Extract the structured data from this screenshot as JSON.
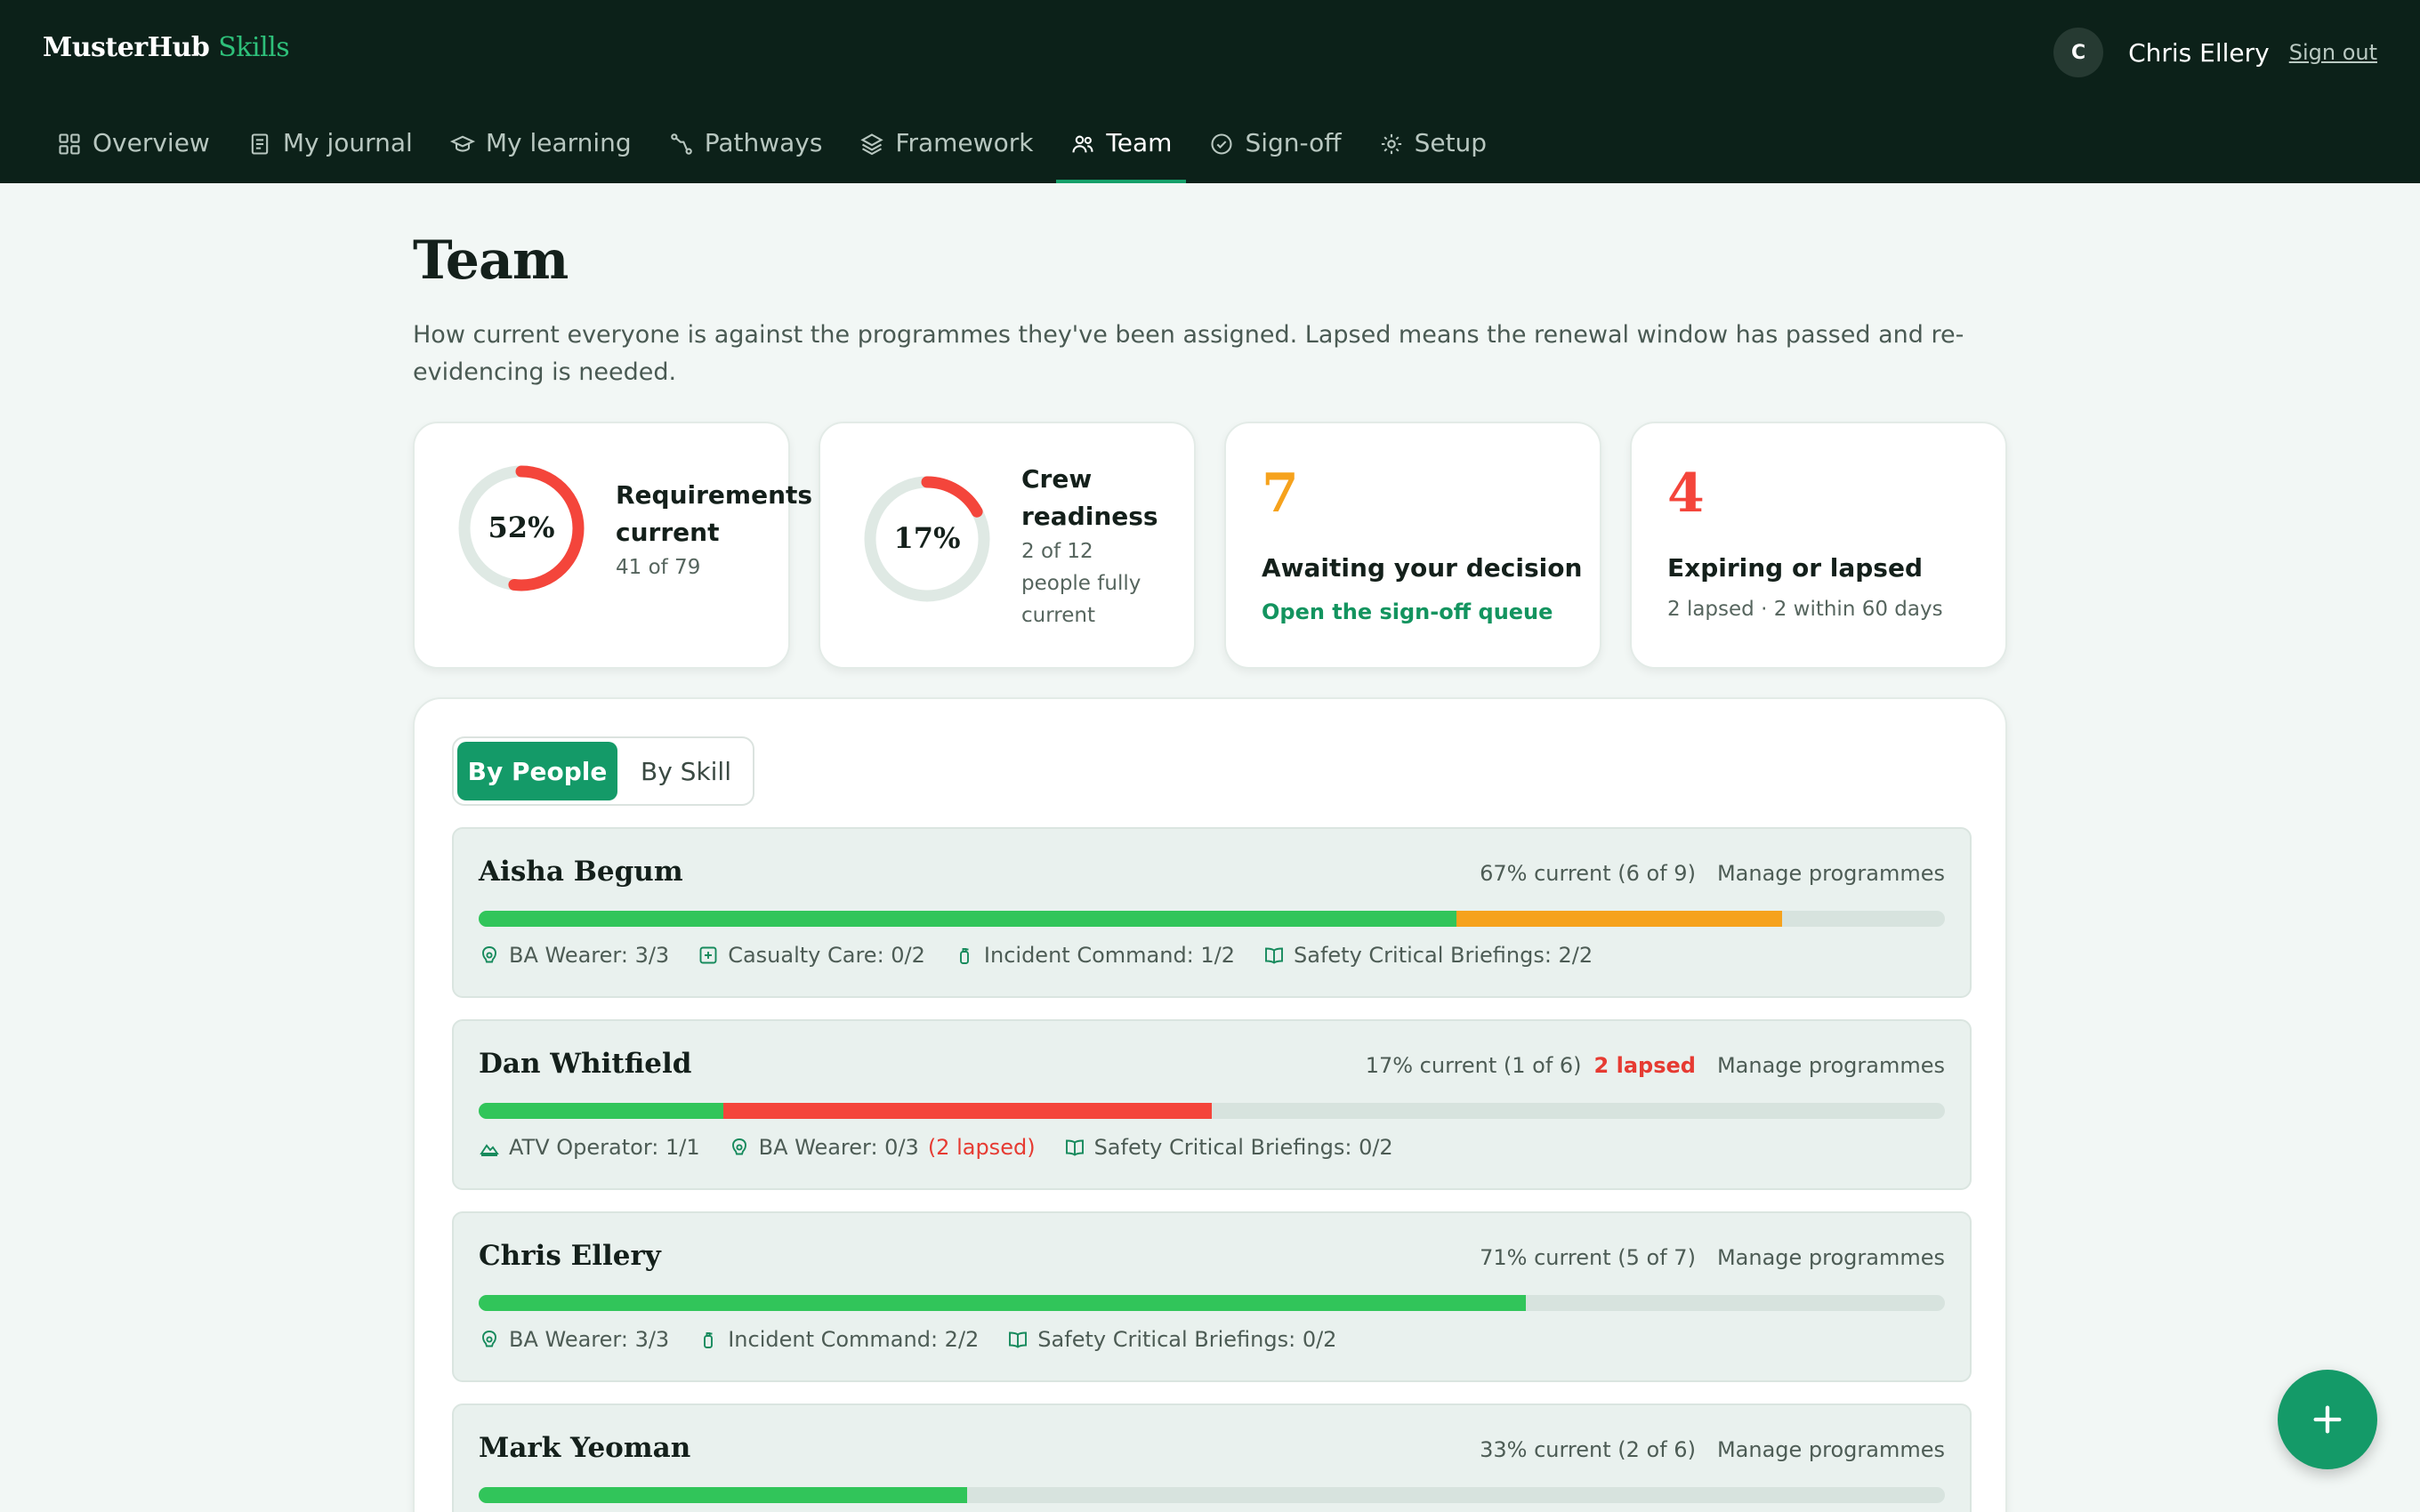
{
  "brand": {
    "name": "MusterHub",
    "accent": "Skills"
  },
  "user": {
    "initial": "C",
    "name": "Chris Ellery",
    "sign_out": "Sign out"
  },
  "nav": {
    "items": [
      {
        "label": "Overview",
        "icon": "grid-icon"
      },
      {
        "label": "My journal",
        "icon": "journal-icon"
      },
      {
        "label": "My learning",
        "icon": "graduation-cap-icon"
      },
      {
        "label": "Pathways",
        "icon": "route-icon"
      },
      {
        "label": "Framework",
        "icon": "layers-icon"
      },
      {
        "label": "Team",
        "icon": "users-icon",
        "active": true
      },
      {
        "label": "Sign-off",
        "icon": "check-circle-icon"
      },
      {
        "label": "Setup",
        "icon": "gear-icon"
      }
    ]
  },
  "page": {
    "title": "Team",
    "description": "How current everyone is against the programmes they've been assigned. Lapsed means the renewal window has passed and re-evidencing is needed."
  },
  "stats": {
    "requirements": {
      "percent_label": "52%",
      "fraction": 0.52,
      "title_line1": "Requirements",
      "title_line2": "current",
      "sub": "41 of 79",
      "color": "#f4453b"
    },
    "readiness": {
      "percent_label": "17%",
      "fraction": 0.17,
      "title_line1": "Crew",
      "title_line2": "readiness",
      "sub_line1": "2 of 12",
      "sub_line2": "people fully",
      "sub_line3": "current",
      "color": "#f4453b"
    },
    "awaiting": {
      "number": "7",
      "heading": "Awaiting your decision",
      "link": "Open the sign-off queue",
      "color": "#f6a21c"
    },
    "expiring": {
      "number": "4",
      "heading": "Expiring or lapsed",
      "sub": "2 lapsed · 2 within 60 days",
      "color": "#f4453b"
    }
  },
  "view_toggle": {
    "by_people": "By People",
    "by_skill": "By Skill"
  },
  "colors": {
    "current": "#31c55a",
    "expiring": "#f6a21c",
    "lapsed": "#f4453b",
    "accent": "#149a68"
  },
  "people": [
    {
      "name": "Aisha Begum",
      "summary": "67% current (6 of 9)",
      "lapsed_label": "",
      "manage": "Manage programmes",
      "current_fraction": 0.667,
      "expiring_fraction": 0.222,
      "lapsed_fraction": 0,
      "chips": [
        {
          "icon": "mask-icon",
          "label": "BA Wearer: 3/3",
          "lapse": ""
        },
        {
          "icon": "medical-plus-icon",
          "label": "Casualty Care: 0/2",
          "lapse": ""
        },
        {
          "icon": "extinguisher-icon",
          "label": "Incident Command: 1/2",
          "lapse": ""
        },
        {
          "icon": "book-icon",
          "label": "Safety Critical Briefings: 2/2",
          "lapse": ""
        }
      ]
    },
    {
      "name": "Dan Whitfield",
      "summary": "17% current (1 of 6)",
      "lapsed_label": "2 lapsed",
      "manage": "Manage programmes",
      "current_fraction": 0.167,
      "expiring_fraction": 0,
      "lapsed_fraction": 0.333,
      "chips": [
        {
          "icon": "terrain-icon",
          "label": "ATV Operator: 1/1",
          "lapse": ""
        },
        {
          "icon": "mask-icon",
          "label": "BA Wearer: 0/3",
          "lapse": "(2 lapsed)"
        },
        {
          "icon": "book-icon",
          "label": "Safety Critical Briefings: 0/2",
          "lapse": ""
        }
      ]
    },
    {
      "name": "Chris Ellery",
      "summary": "71% current (5 of 7)",
      "lapsed_label": "",
      "manage": "Manage programmes",
      "current_fraction": 0.714,
      "expiring_fraction": 0,
      "lapsed_fraction": 0,
      "chips": [
        {
          "icon": "mask-icon",
          "label": "BA Wearer: 3/3",
          "lapse": ""
        },
        {
          "icon": "extinguisher-icon",
          "label": "Incident Command: 2/2",
          "lapse": ""
        },
        {
          "icon": "book-icon",
          "label": "Safety Critical Briefings: 0/2",
          "lapse": ""
        }
      ]
    },
    {
      "name": "Mark Yeoman",
      "summary": "33% current (2 of 6)",
      "lapsed_label": "",
      "manage": "Manage programmes",
      "current_fraction": 0.333,
      "expiring_fraction": 0,
      "lapsed_fraction": 0,
      "chips": []
    }
  ],
  "fab": {
    "icon": "plus-icon"
  }
}
